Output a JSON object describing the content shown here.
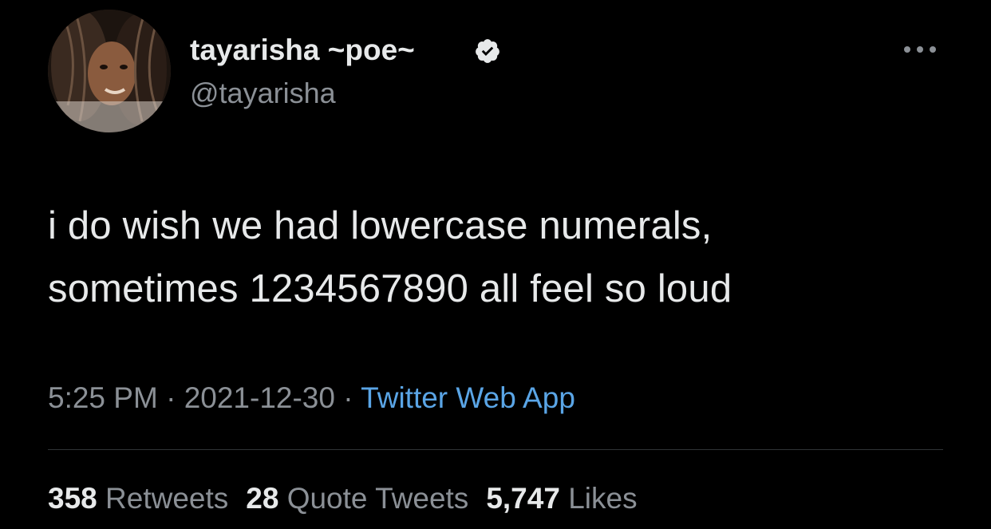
{
  "user": {
    "display_name": "tayarisha ~poe~",
    "handle": "@tayarisha",
    "verified_icon": "verified-badge-icon",
    "more_icon": "more-options-icon"
  },
  "tweet": {
    "lines": [
      "i do wish we had lowercase numerals,",
      "sometimes 1234567890 all feel so loud"
    ]
  },
  "meta": {
    "time": "5:25 PM",
    "separator": " · ",
    "date": "2021-12-30",
    "source": "Twitter Web App"
  },
  "stats": {
    "retweets_count": "358",
    "retweets_label": "Retweets",
    "quotes_count": "28",
    "quotes_label": "Quote Tweets",
    "likes_count": "5,747",
    "likes_label": "Likes"
  },
  "colors": {
    "background": "#000000",
    "text_primary": "#e7e9ea",
    "text_secondary": "#8b9096",
    "link": "#5aa5e6",
    "divider": "#2f3336"
  }
}
